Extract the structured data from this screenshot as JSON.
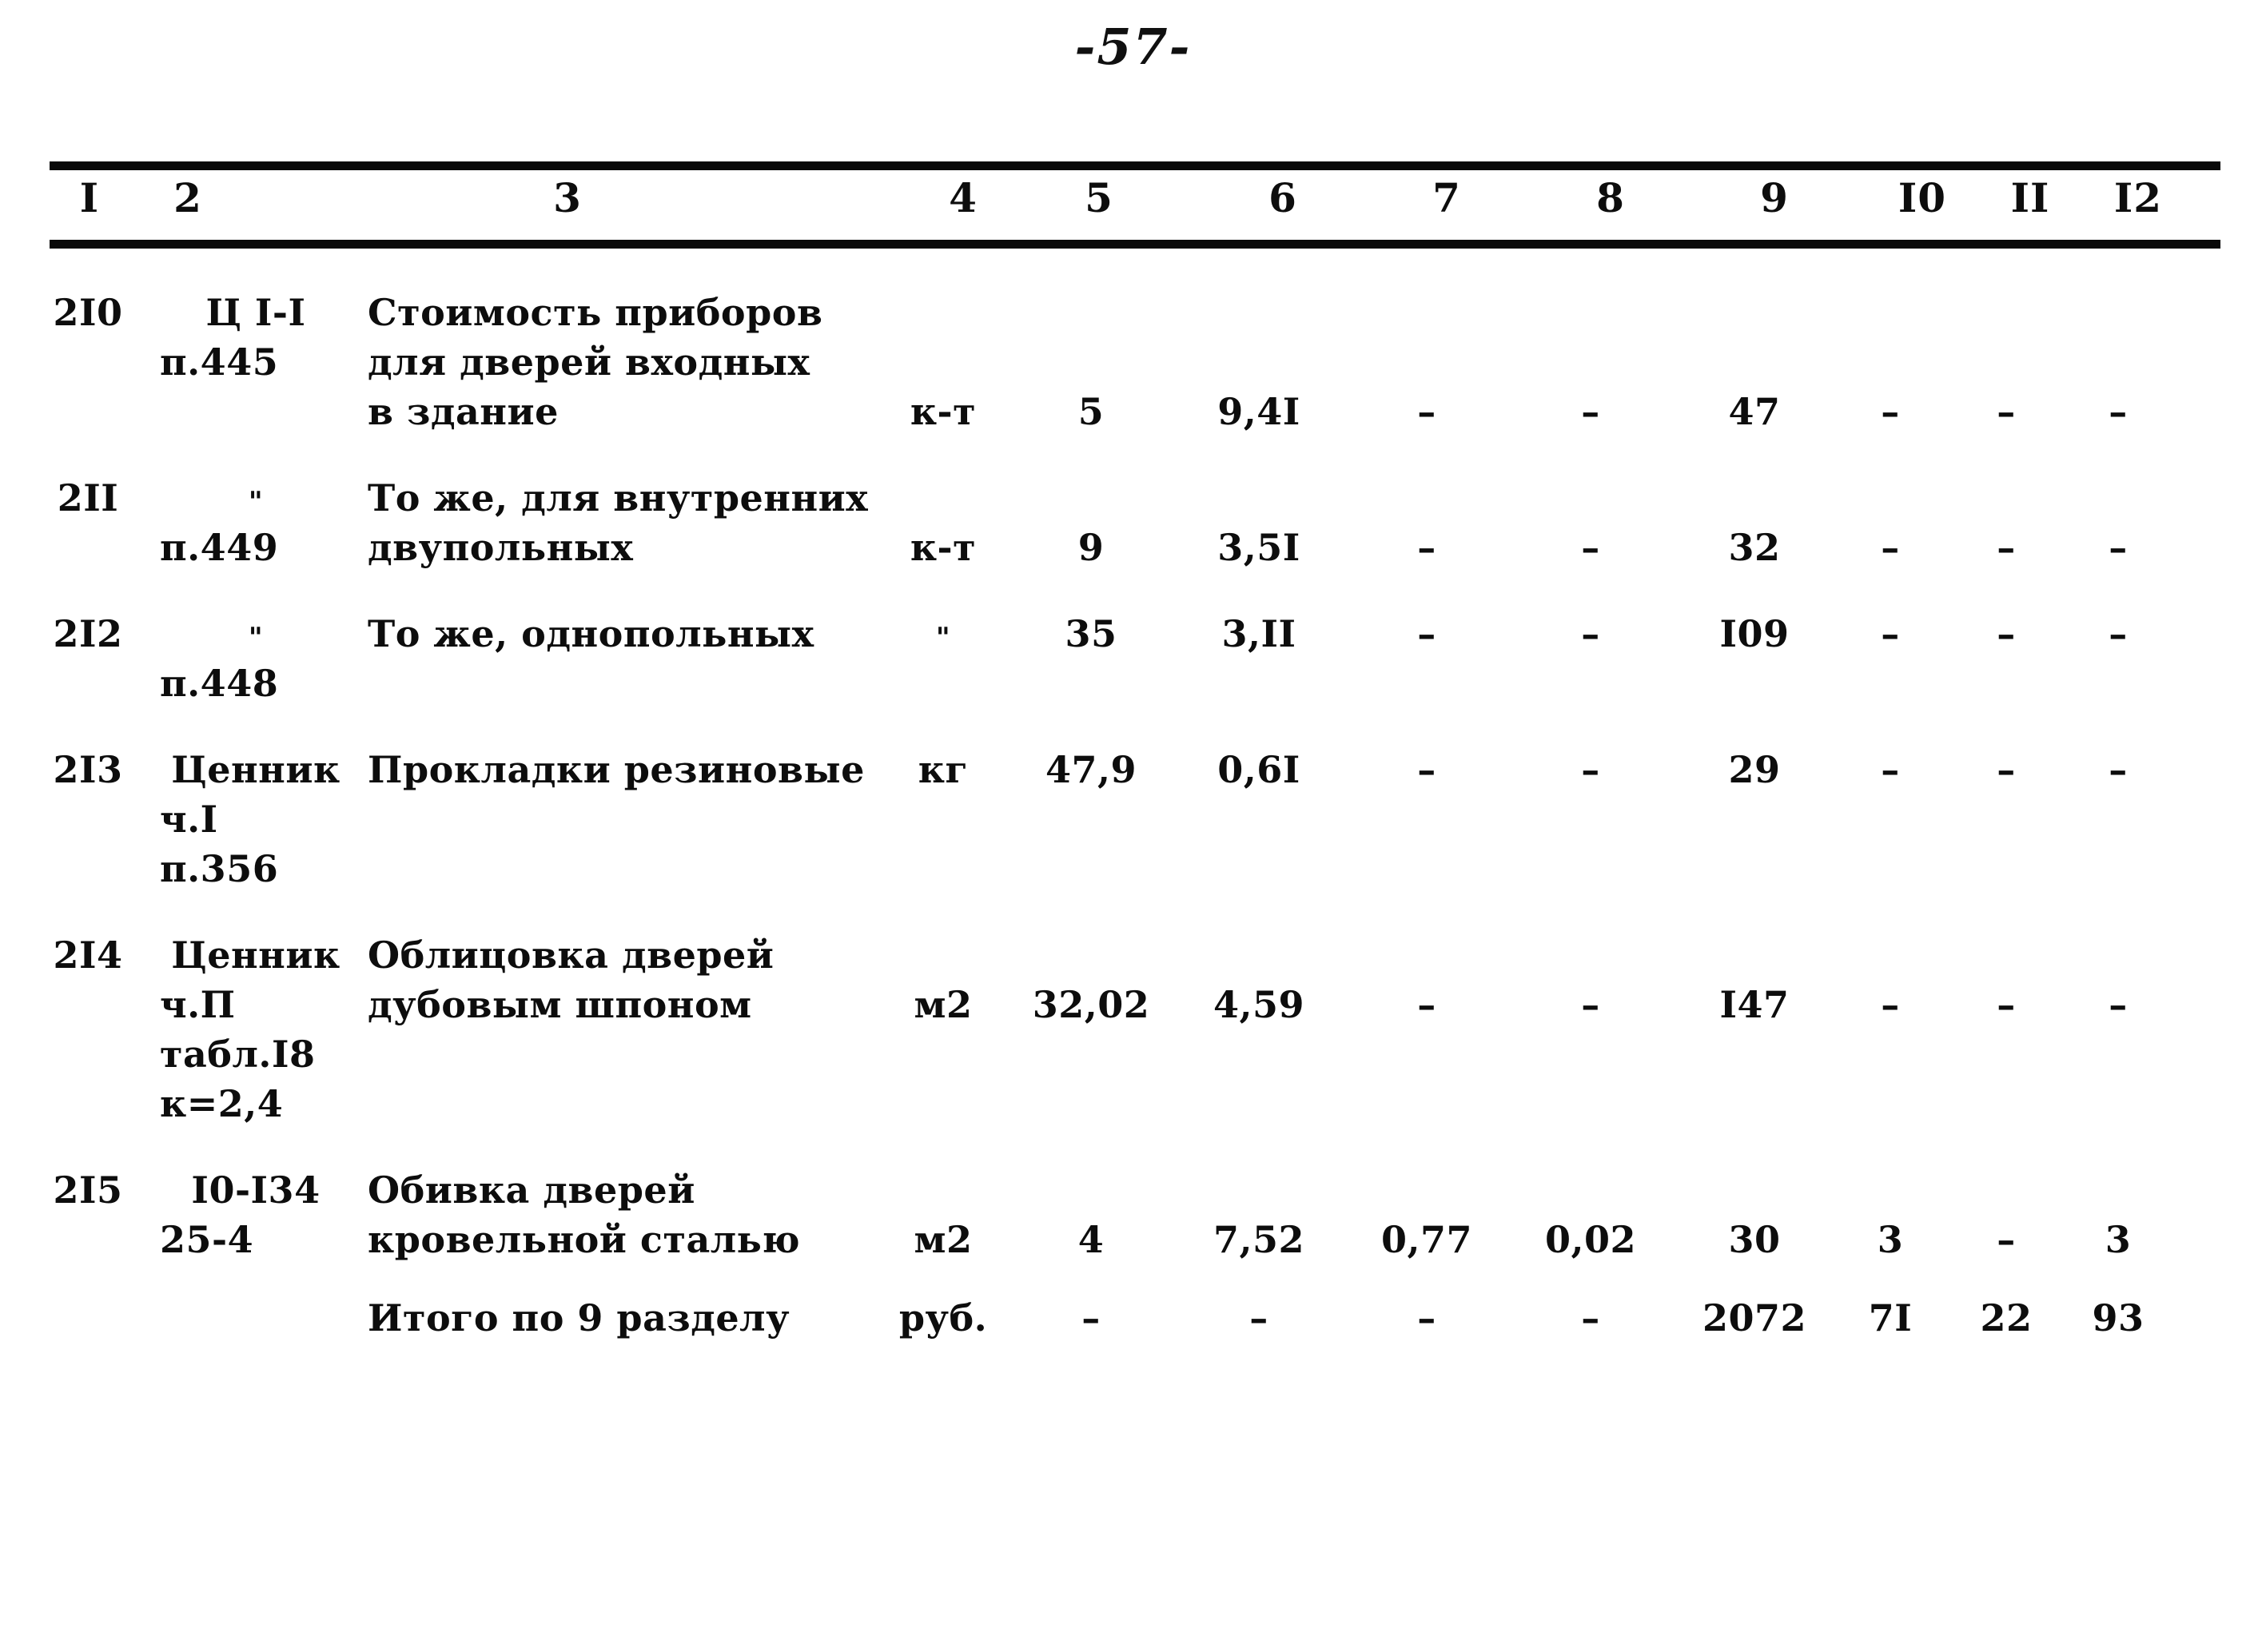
{
  "document": {
    "page_number": "-57-",
    "language": "ru"
  },
  "table": {
    "column_headers": [
      "I",
      "2",
      "3",
      "4",
      "5",
      "6",
      "7",
      "8",
      "9",
      "I0",
      "II",
      "I2"
    ],
    "header_x": [
      62,
      185,
      660,
      1155,
      1325,
      1555,
      1760,
      1965,
      2170,
      2355,
      2490,
      2625
    ],
    "rows": [
      {
        "no": "2I0",
        "code": [
          "Ц I-I",
          "п.445"
        ],
        "description": [
          "Стоимость приборов",
          "для дверей входных",
          "в здание"
        ],
        "unit": "к-т",
        "qty": "5",
        "price": "9,4I",
        "c7": "–",
        "c8": "–",
        "c9": "47",
        "c10": "–",
        "c11": "–",
        "c12": "–",
        "value_line": 2
      },
      {
        "no": "2II",
        "code": [
          "\"",
          "п.449"
        ],
        "description": [
          "То же, для внутренних",
          "двупольных"
        ],
        "unit": "к-т",
        "qty": "9",
        "price": "3,5I",
        "c7": "–",
        "c8": "–",
        "c9": "32",
        "c10": "–",
        "c11": "–",
        "c12": "–",
        "value_line": 1
      },
      {
        "no": "2I2",
        "code": [
          "\"",
          "п.448"
        ],
        "description": [
          "То же, однопольных"
        ],
        "unit": "\"",
        "qty": "35",
        "price": "3,II",
        "c7": "–",
        "c8": "–",
        "c9": "I09",
        "c10": "–",
        "c11": "–",
        "c12": "–",
        "value_line": 0
      },
      {
        "no": "2I3",
        "code": [
          "Ценник",
          "ч.I",
          "п.356"
        ],
        "description": [
          "Прокладки резиновые"
        ],
        "unit": "кг",
        "qty": "47,9",
        "price": "0,6I",
        "c7": "–",
        "c8": "–",
        "c9": "29",
        "c10": "–",
        "c11": "–",
        "c12": "–",
        "value_line": 0
      },
      {
        "no": "2I4",
        "code": [
          "Ценник",
          "ч.П",
          "табл.I8",
          "к=2,4"
        ],
        "description": [
          "Облицовка дверей",
          "дубовым шпоном"
        ],
        "unit": "м2",
        "qty": "32,02",
        "price": "4,59",
        "c7": "–",
        "c8": "–",
        "c9": "I47",
        "c10": "–",
        "c11": "–",
        "c12": "–",
        "value_line": 1
      },
      {
        "no": "2I5",
        "code": [
          "I0-I34",
          "25-4"
        ],
        "description": [
          "Обивка дверей",
          "кровельной сталью"
        ],
        "unit": "м2",
        "qty": "4",
        "price": "7,52",
        "c7": "0,77",
        "c8": "0,02",
        "c9": "30",
        "c10": "3",
        "c11": "–",
        "c12": "3",
        "value_line": 1
      }
    ],
    "total_row": {
      "no": "",
      "code": [],
      "description": [
        "Итого по 9 разделу"
      ],
      "unit": "руб.",
      "qty": "–",
      "price": "–",
      "c7": "–",
      "c8": "–",
      "c9": "2072",
      "c10": "7I",
      "c11": "22",
      "c12": "93",
      "value_line": 0
    }
  }
}
